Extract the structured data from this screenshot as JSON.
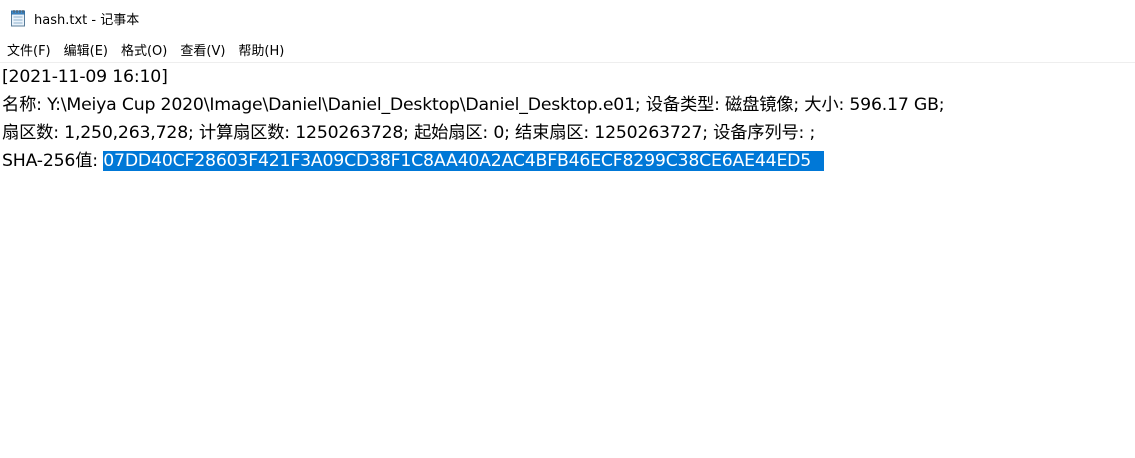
{
  "window": {
    "title": "hash.txt - 记事本",
    "icon": "notepad-icon"
  },
  "menu": {
    "items": [
      {
        "label": "文件(F)"
      },
      {
        "label": "编辑(E)"
      },
      {
        "label": "格式(O)"
      },
      {
        "label": "查看(V)"
      },
      {
        "label": "帮助(H)"
      }
    ]
  },
  "document": {
    "lines": [
      "[2021-11-09 16:10]",
      "名称: Y:\\Meiya Cup 2020\\Image\\Daniel\\Daniel_Desktop\\Daniel_Desktop.e01; 设备类型: 磁盘镜像; 大小: 596.17 GB;",
      "扇区数: 1,250,263,728; 计算扇区数: 1250263728; 起始扇区: 0; 结束扇区: 1250263727; 设备序列号: ;"
    ],
    "hash_label": "SHA-256值: ",
    "hash_value": "07DD40CF28603F421F3A09CD38F1C8AA40A2AC4BFB46ECF8299C38CE6AE44ED5"
  },
  "colors": {
    "selection_bg": "#0078d7",
    "selection_text": "#ffffff"
  }
}
